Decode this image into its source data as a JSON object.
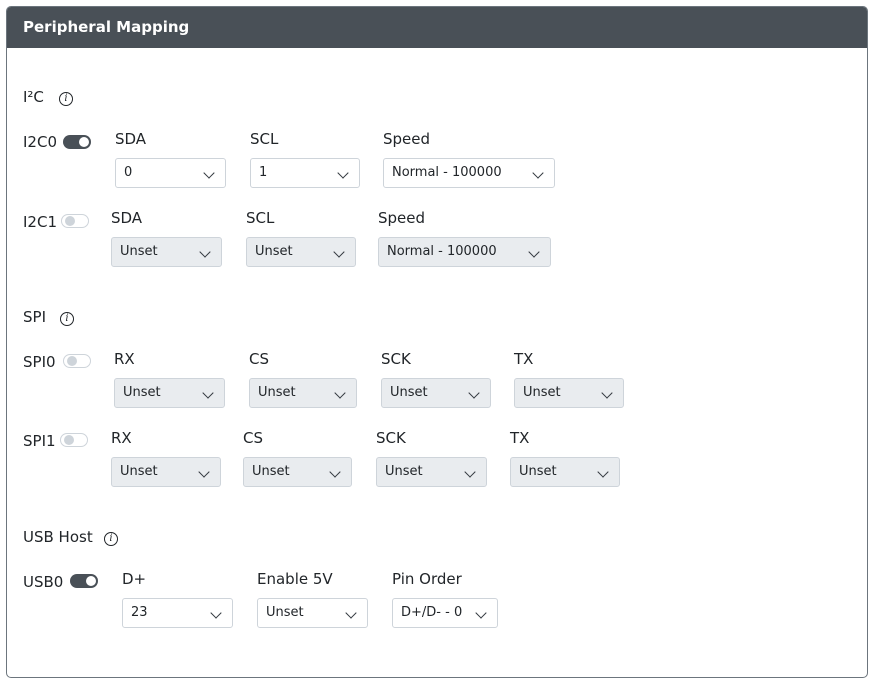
{
  "header": {
    "title": "Peripheral Mapping"
  },
  "sections": {
    "i2c": {
      "title": "I²C"
    },
    "spi": {
      "title": "SPI"
    },
    "usb": {
      "title": "USB Host"
    }
  },
  "i2c0": {
    "label": "I2C0",
    "enabled": true,
    "sda": {
      "label": "SDA",
      "value": "0"
    },
    "scl": {
      "label": "SCL",
      "value": "1"
    },
    "speed": {
      "label": "Speed",
      "value": "Normal - 100000"
    }
  },
  "i2c1": {
    "label": "I2C1",
    "enabled": false,
    "sda": {
      "label": "SDA",
      "value": "Unset"
    },
    "scl": {
      "label": "SCL",
      "value": "Unset"
    },
    "speed": {
      "label": "Speed",
      "value": "Normal - 100000"
    }
  },
  "spi0": {
    "label": "SPI0",
    "enabled": false,
    "rx": {
      "label": "RX",
      "value": "Unset"
    },
    "cs": {
      "label": "CS",
      "value": "Unset"
    },
    "sck": {
      "label": "SCK",
      "value": "Unset"
    },
    "tx": {
      "label": "TX",
      "value": "Unset"
    }
  },
  "spi1": {
    "label": "SPI1",
    "enabled": false,
    "rx": {
      "label": "RX",
      "value": "Unset"
    },
    "cs": {
      "label": "CS",
      "value": "Unset"
    },
    "sck": {
      "label": "SCK",
      "value": "Unset"
    },
    "tx": {
      "label": "TX",
      "value": "Unset"
    }
  },
  "usb0": {
    "label": "USB0",
    "enabled": true,
    "dplus": {
      "label": "D+",
      "value": "23"
    },
    "enable5v": {
      "label": "Enable 5V",
      "value": "Unset"
    },
    "pinorder": {
      "label": "Pin Order",
      "value": "D+/D- - 0"
    }
  },
  "icons": {
    "info": "info-icon",
    "toggle": "toggle-switch",
    "dropdown": "chevron-down-icon"
  }
}
